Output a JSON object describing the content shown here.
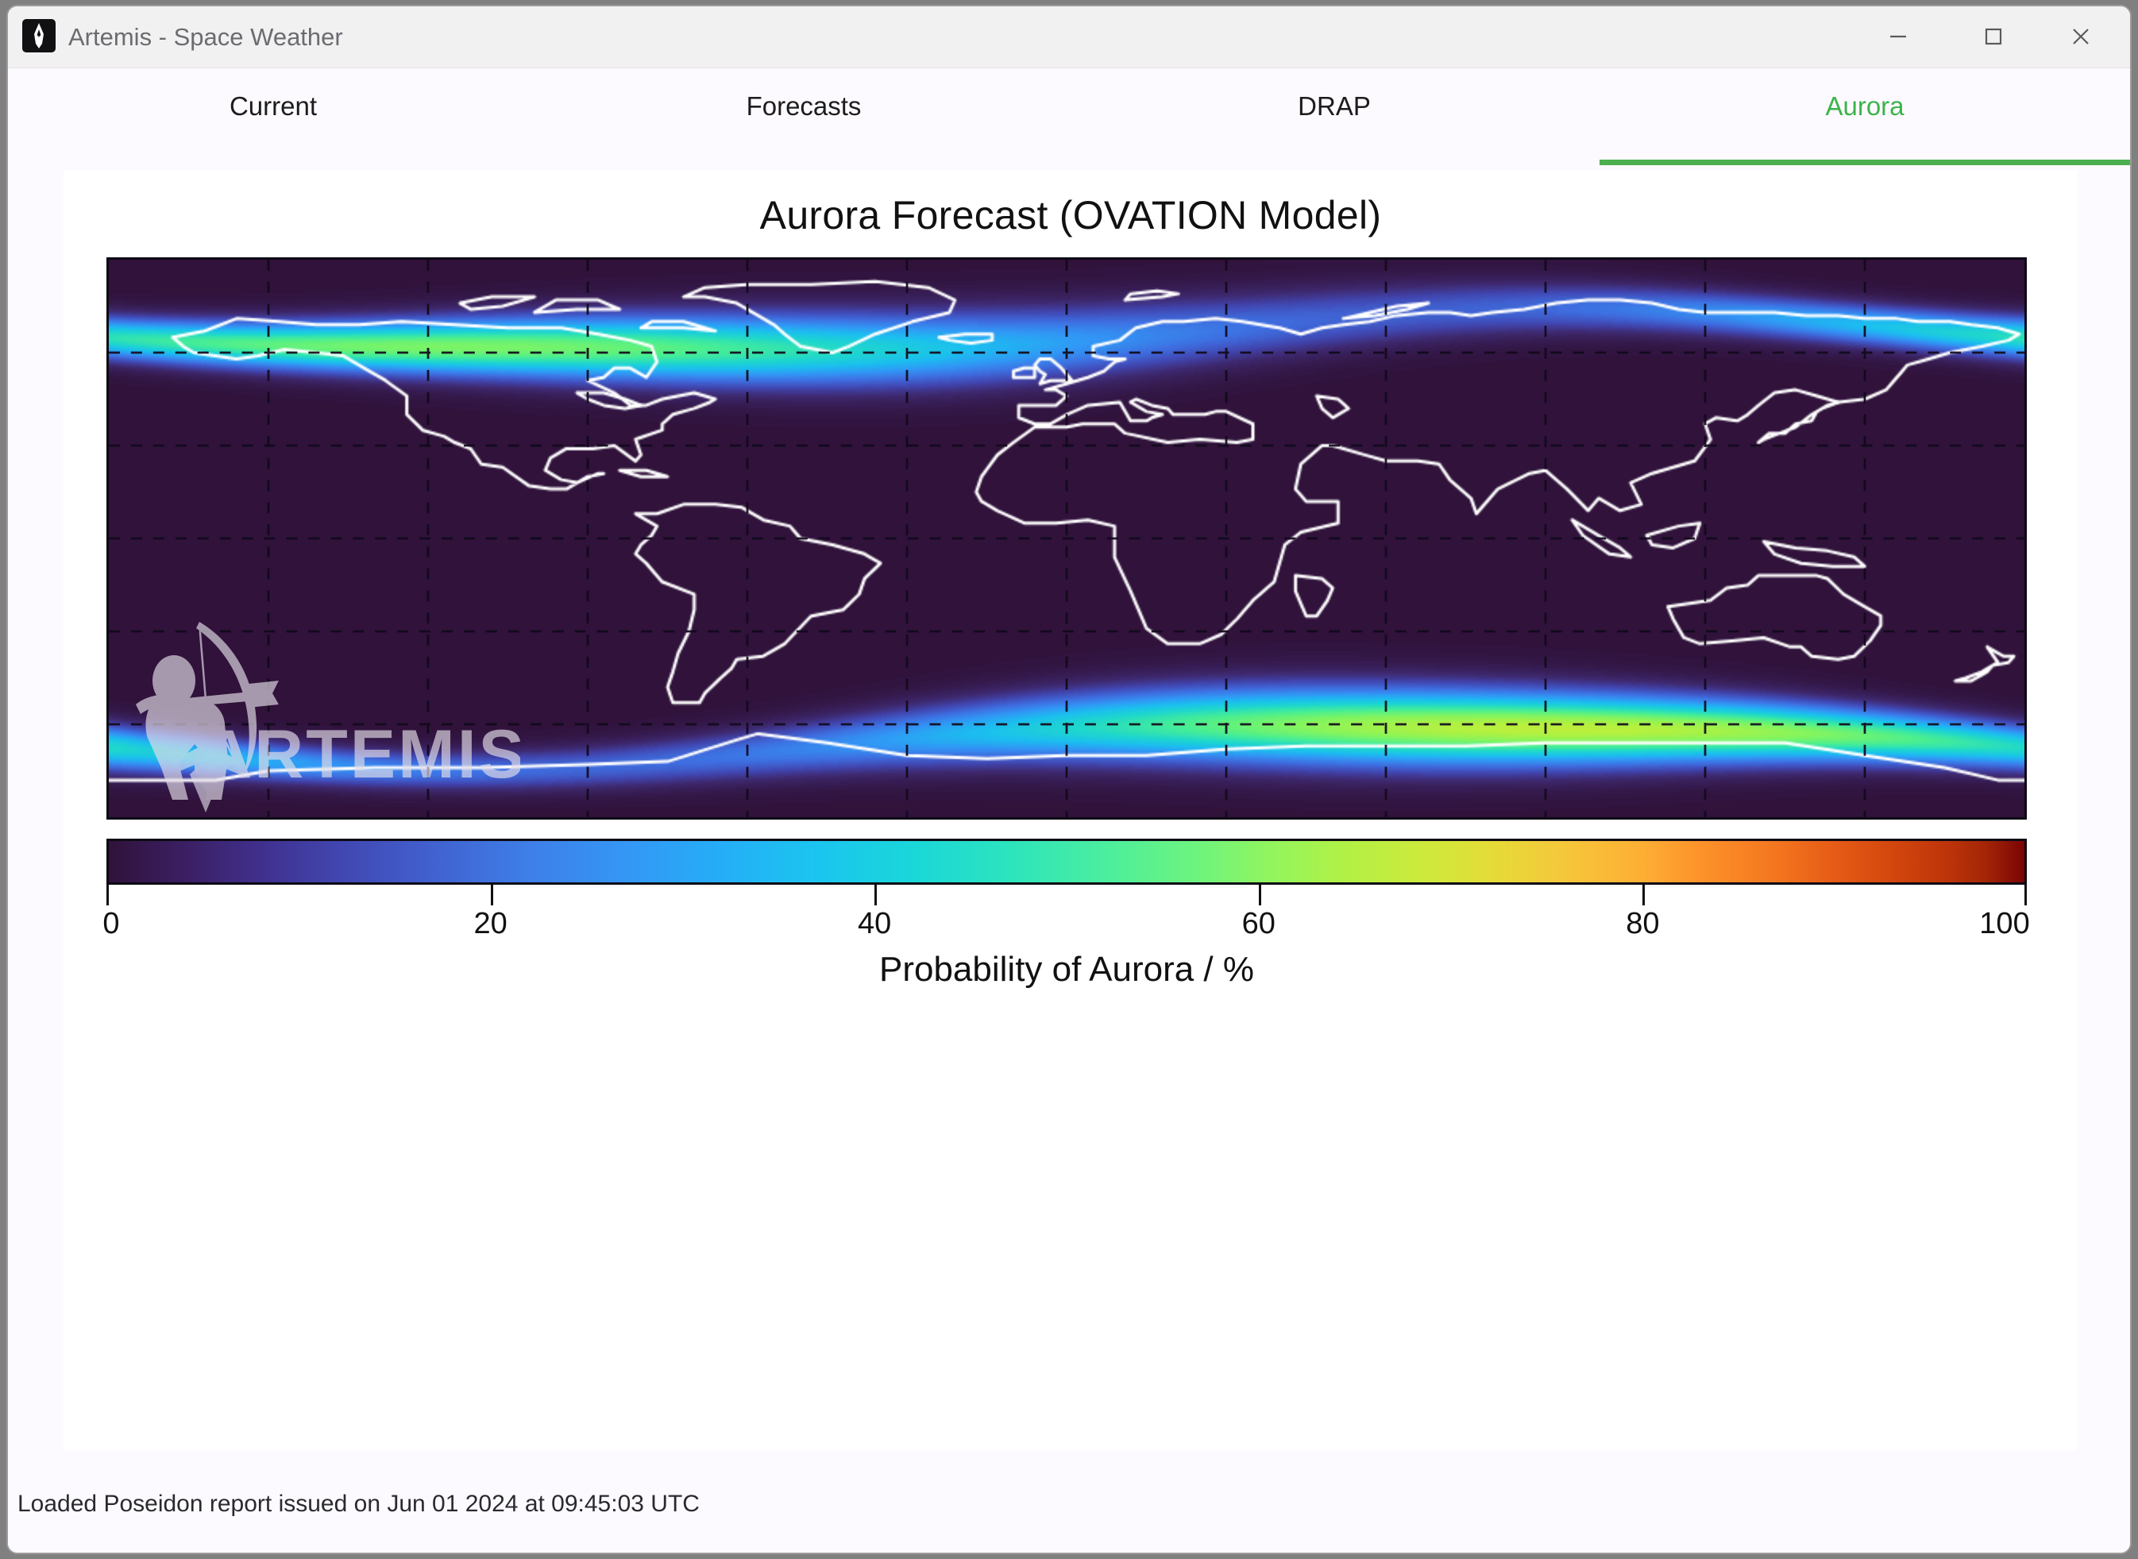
{
  "window": {
    "title": "Artemis - Space Weather",
    "icon": "artemis-logo-icon",
    "controls": {
      "minimize": "minimize-icon",
      "maximize": "maximize-icon",
      "close": "close-icon"
    }
  },
  "tabs": [
    {
      "label": "Current",
      "active": false
    },
    {
      "label": "Forecasts",
      "active": false
    },
    {
      "label": "DRAP",
      "active": false
    },
    {
      "label": "Aurora",
      "active": true
    }
  ],
  "accent": {
    "active_tab_text": "#3cb44a",
    "active_tab_underline": "#4caf50"
  },
  "status": {
    "text": "Loaded Poseidon report issued on Jun 01 2024 at 09:45:03 UTC"
  },
  "watermark": {
    "text": "ARTEMIS"
  },
  "chart_data": {
    "type": "heatmap",
    "title": "Aurora Forecast (OVATION Model)",
    "xlabel": "",
    "ylabel": "",
    "colorbar": {
      "label": "Probability of Aurora / %",
      "ticks": [
        0,
        20,
        40,
        60,
        80,
        100
      ],
      "tick_labels": [
        "0",
        "20",
        "40",
        "60",
        "80",
        "100"
      ],
      "range": [
        0,
        100
      ],
      "orientation": "horizontal",
      "colormap": "turbo",
      "colormap_stops": [
        "#30123b",
        "#4146b0",
        "#3e7fe8",
        "#1bc5ef",
        "#2ce4bd",
        "#6ff47c",
        "#b5f043",
        "#e4dc38",
        "#fdaf34",
        "#f4761f",
        "#d4470e",
        "#7a0403"
      ]
    },
    "projection": "equirectangular",
    "xlim": [
      -180,
      180
    ],
    "ylim": [
      -90,
      90
    ],
    "grid": true,
    "grid_style": "dashed",
    "grid_lon_step": 30,
    "grid_lat_step": 30,
    "background_color": "#2e1642",
    "coastline_color": "#ffffff",
    "legend": "colorbar-bottom",
    "annotations": [
      "Northern auroral oval across Alaska, northern Canada, Greenland, Scandinavia and Siberia",
      "Southern auroral oval over the Antarctic and Southern Ocean"
    ],
    "auroral_ovals": [
      {
        "name": "northern-oval",
        "hemisphere": "north",
        "peak_probability": 45,
        "lat_center_deg": 66,
        "lat_halfwidth_deg": 9
      },
      {
        "name": "southern-oval",
        "hemisphere": "south",
        "peak_probability": 48,
        "lat_center_deg": -66,
        "lat_halfwidth_deg": 9
      }
    ]
  }
}
